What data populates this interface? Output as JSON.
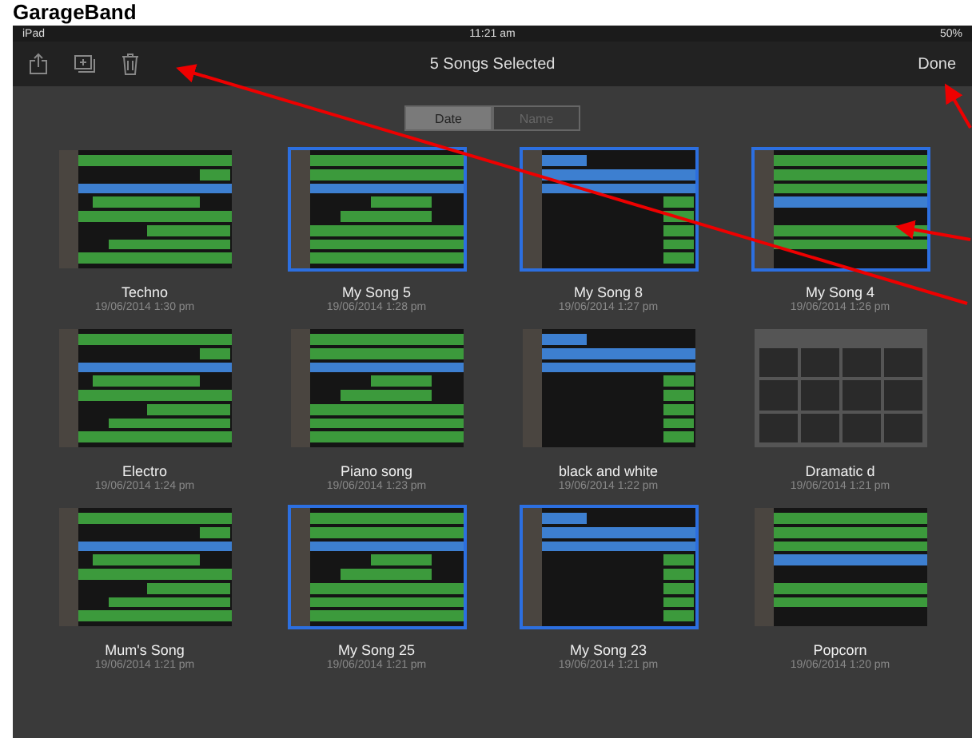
{
  "heading": "GarageBand",
  "status_bar": {
    "device": "iPad",
    "time": "11:21 am",
    "battery": "50%"
  },
  "nav_bar": {
    "title": "5 Songs Selected",
    "done": "Done"
  },
  "sort": [
    {
      "label": "Date",
      "selected": true
    },
    {
      "label": "Name",
      "selected": false
    }
  ],
  "songs": [
    {
      "name": "Techno",
      "date": "19/06/2014 1:30 pm",
      "selected": false,
      "kind": "tracks"
    },
    {
      "name": "My Song 5",
      "date": "19/06/2014 1:28 pm",
      "selected": true,
      "kind": "tracks"
    },
    {
      "name": "My Song 8",
      "date": "19/06/2014 1:27 pm",
      "selected": true,
      "kind": "tracks"
    },
    {
      "name": "My Song 4",
      "date": "19/06/2014 1:26 pm",
      "selected": true,
      "kind": "tracks"
    },
    {
      "name": "Electro",
      "date": "19/06/2014 1:24 pm",
      "selected": false,
      "kind": "tracks"
    },
    {
      "name": "Piano song",
      "date": "19/06/2014 1:23 pm",
      "selected": false,
      "kind": "tracks"
    },
    {
      "name": "black and white",
      "date": "19/06/2014 1:22 pm",
      "selected": false,
      "kind": "tracks"
    },
    {
      "name": "Dramatic d",
      "date": "19/06/2014 1:21 pm",
      "selected": false,
      "kind": "drums"
    },
    {
      "name": "Mum's Song",
      "date": "19/06/2014 1:21 pm",
      "selected": false,
      "kind": "tracks"
    },
    {
      "name": "My Song 25",
      "date": "19/06/2014 1:21 pm",
      "selected": true,
      "kind": "tracks"
    },
    {
      "name": "My Song 23",
      "date": "19/06/2014 1:21 pm",
      "selected": true,
      "kind": "tracks"
    },
    {
      "name": "Popcorn",
      "date": "19/06/2014 1:20 pm",
      "selected": false,
      "kind": "tracks"
    }
  ]
}
